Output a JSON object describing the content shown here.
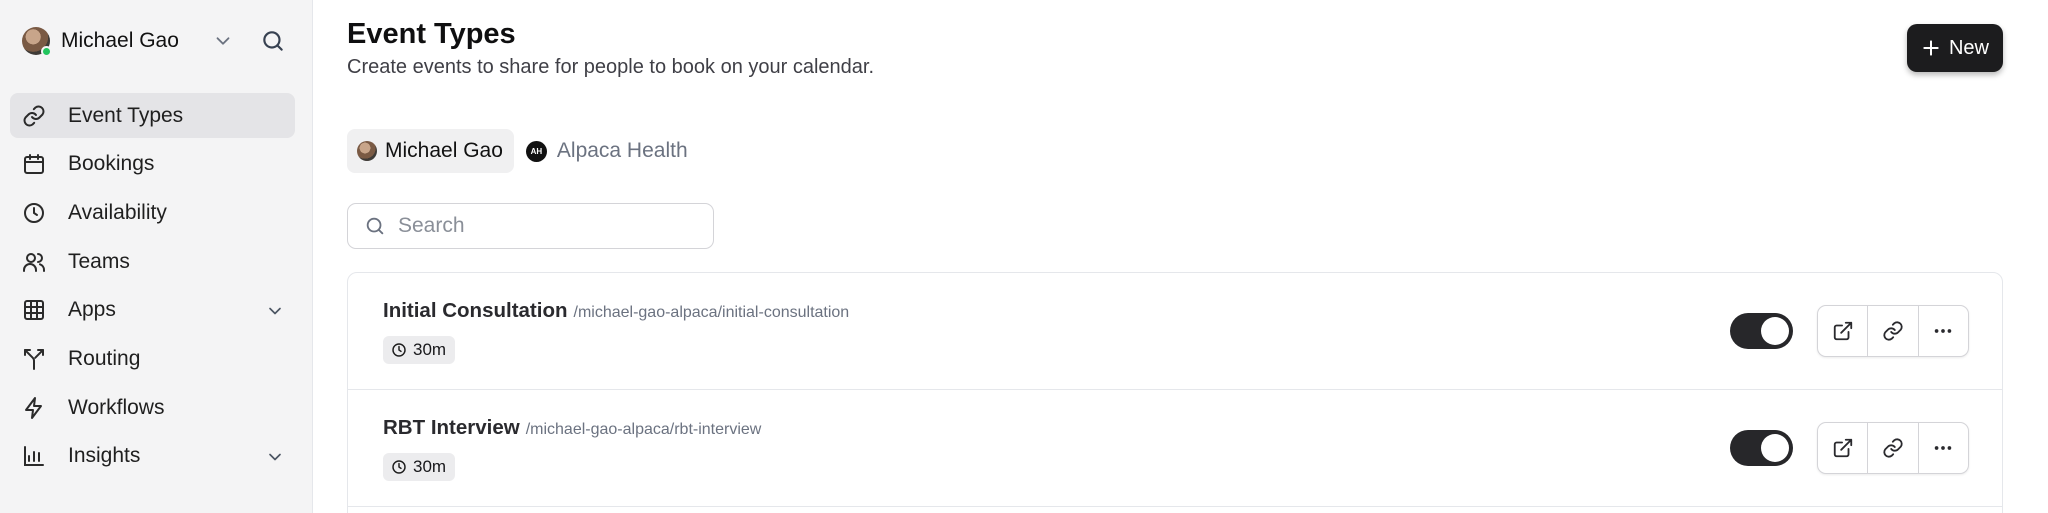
{
  "user": {
    "name": "Michael Gao"
  },
  "sidebar": {
    "items": [
      {
        "label": "Event Types",
        "icon": "link-icon",
        "active": true
      },
      {
        "label": "Bookings",
        "icon": "calendar-icon"
      },
      {
        "label": "Availability",
        "icon": "clock-icon"
      },
      {
        "label": "Teams",
        "icon": "users-icon"
      },
      {
        "label": "Apps",
        "icon": "grid-icon",
        "expandable": true
      },
      {
        "label": "Routing",
        "icon": "split-icon"
      },
      {
        "label": "Workflows",
        "icon": "zap-icon"
      },
      {
        "label": "Insights",
        "icon": "bar-chart-icon",
        "expandable": true
      }
    ]
  },
  "header": {
    "title": "Event Types",
    "subtitle": "Create events to share for people to book on your calendar.",
    "new_label": "New"
  },
  "filters": [
    {
      "label": "Michael Gao",
      "active": true
    },
    {
      "label": "Alpaca Health",
      "logo_text": "AH"
    }
  ],
  "search": {
    "placeholder": "Search",
    "value": ""
  },
  "event_types": [
    {
      "name": "Initial Consultation",
      "slug": "/michael-gao-alpaca/initial-consultation",
      "duration": "30m",
      "enabled": true
    },
    {
      "name": "RBT Interview",
      "slug": "/michael-gao-alpaca/rbt-interview",
      "duration": "30m",
      "enabled": true
    }
  ],
  "colors": {
    "primary": "#1c1c1e",
    "sidebar_bg": "#f4f4f5",
    "active_item": "#e4e4e7",
    "online": "#22c55e"
  }
}
